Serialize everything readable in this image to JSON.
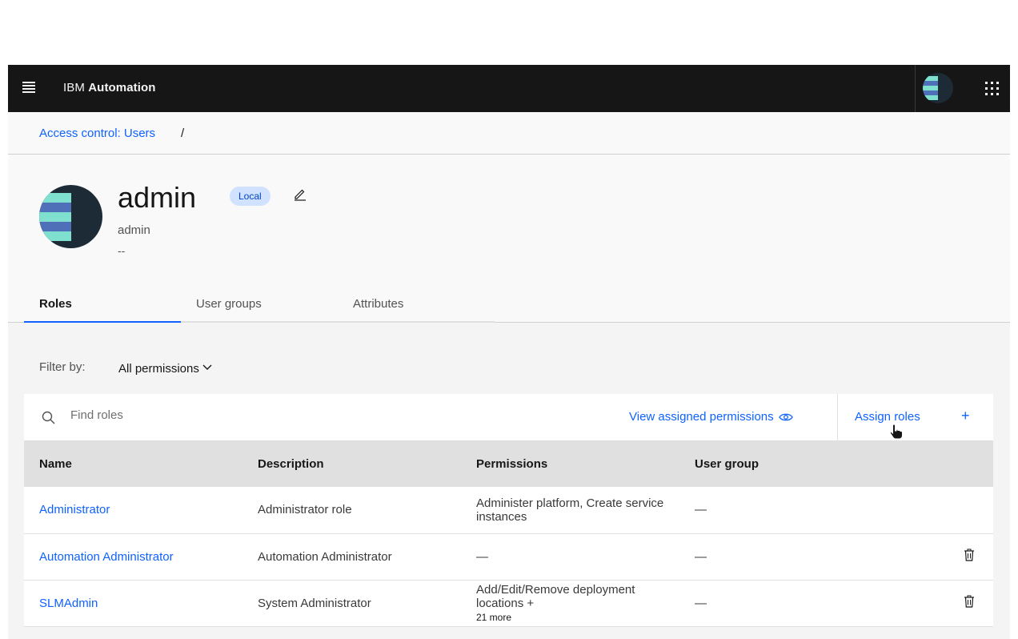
{
  "header": {
    "brand_prefix": "IBM ",
    "brand_name": "Automation"
  },
  "breadcrumb": {
    "link": "Access control: Users",
    "separator": "/"
  },
  "user": {
    "name": "admin",
    "badge": "Local",
    "email": "admin",
    "extra": "--"
  },
  "tabs": [
    {
      "label": "Roles",
      "active": true
    },
    {
      "label": "User groups",
      "active": false
    },
    {
      "label": "Attributes",
      "active": false
    }
  ],
  "filter": {
    "label": "Filter by:",
    "value": "All permissions"
  },
  "toolbar": {
    "search_placeholder": "Find roles",
    "view_permissions": "View assigned permissions",
    "assign_roles": "Assign roles",
    "assign_icon": "+"
  },
  "table": {
    "columns": [
      "Name",
      "Description",
      "Permissions",
      "User group"
    ],
    "rows": [
      {
        "name": "Administrator",
        "description": "Administrator role",
        "permissions": "Administer platform, Create service instances",
        "more": "",
        "user_group": "—",
        "deletable": false
      },
      {
        "name": "Automation Administrator",
        "description": "Automation Administrator",
        "permissions": "—",
        "more": "",
        "user_group": "—",
        "deletable": true
      },
      {
        "name": "SLMAdmin",
        "description": "System Administrator",
        "permissions": "Add/Edit/Remove deployment locations +",
        "more": "21 more",
        "user_group": "—",
        "deletable": true
      }
    ]
  },
  "colors": {
    "accent": "#0f62fe",
    "topbar": "#161616",
    "badge_bg": "#d0e2ff",
    "avatar_teal": "#7fe0cf",
    "avatar_indigo": "#4f6fb8",
    "avatar_dark": "#1d2b36"
  },
  "icons": {
    "menu": "hamburger-menu-icon",
    "switcher": "app-switcher-icon",
    "edit": "pencil-edit-icon",
    "search": "search-icon",
    "view": "eye-icon",
    "delete": "trash-icon",
    "filter_chevron": "chevron-down-icon"
  }
}
